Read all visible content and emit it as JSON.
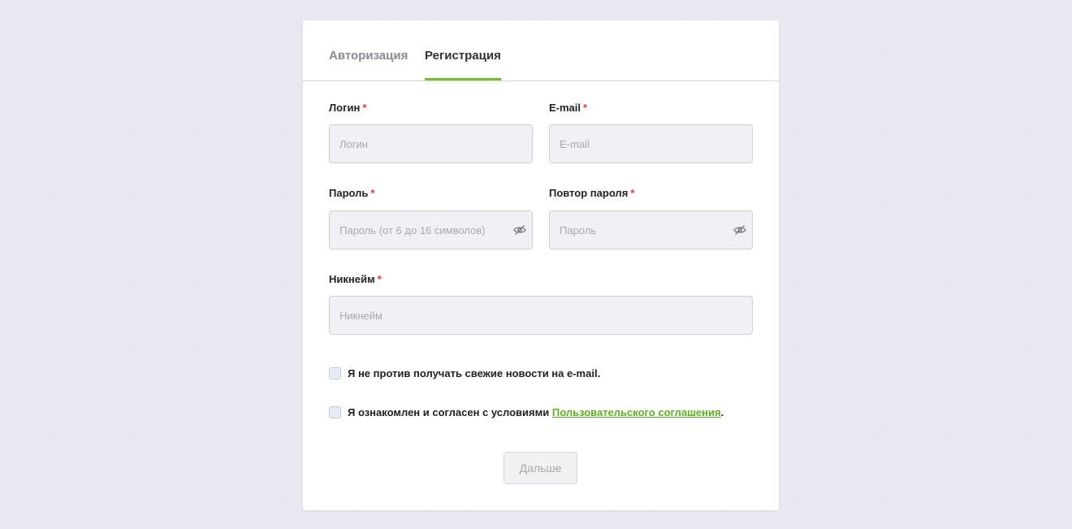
{
  "tabs": {
    "auth_label": "Авторизация",
    "register_label": "Регистрация"
  },
  "form": {
    "login": {
      "label": "Логин",
      "required": "*",
      "placeholder": "Логин",
      "value": ""
    },
    "email": {
      "label": "E-mail",
      "required": "*",
      "placeholder": "E-mail",
      "value": ""
    },
    "password": {
      "label": "Пароль",
      "required": "*",
      "placeholder": "Пароль (от 6 до 16 символов)",
      "value": ""
    },
    "password_repeat": {
      "label": "Повтор пароля",
      "required": "*",
      "placeholder": "Пароль",
      "value": ""
    },
    "nickname": {
      "label": "Никнейм",
      "required": "*",
      "placeholder": "Никнейм",
      "value": ""
    },
    "newsletter": {
      "label": "Я не против получать свежие новости на e-mail.",
      "checked": false
    },
    "terms": {
      "prefix": "Я ознакомлен и согласен с условиями",
      "link": "Пользовательского соглашения",
      "suffix": ".",
      "checked": false
    },
    "submit_label": "Дальше"
  },
  "colors": {
    "accent": "#6fbf2e",
    "link": "#5cb21f",
    "required": "#e53935",
    "input_bg": "#f1f1f5",
    "page_bg": "#f4f4f9"
  },
  "icons": {
    "password_toggle": "eye-slash-icon"
  }
}
